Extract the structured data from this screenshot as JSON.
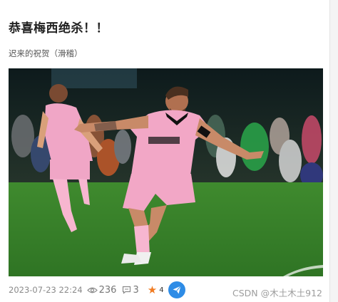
{
  "post": {
    "title": "恭喜梅西绝杀！！",
    "summary": "迟来的祝贺（滑稽）"
  },
  "footer": {
    "date": "2023-07-23 22:24",
    "views": "236",
    "comments": "3",
    "favorites": "4",
    "view_icon": "eye-icon",
    "comment_icon": "comment-icon",
    "favorite_icon": "star-icon",
    "share_icon": "paper-plane-icon"
  },
  "watermark": "CSDN @木土木土912",
  "colors": {
    "star": "#f07b22",
    "share_button": "#2e8ce6",
    "jersey_pink": "#f2a7c6"
  }
}
